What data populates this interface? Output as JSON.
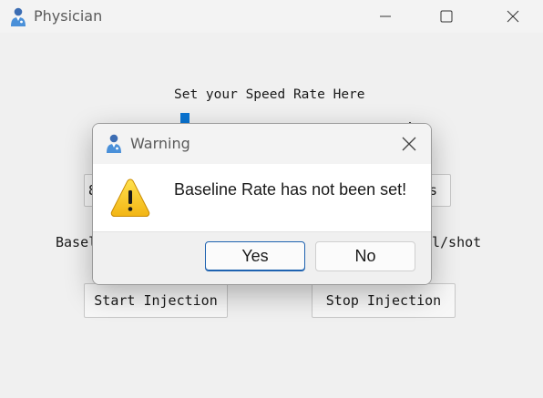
{
  "window": {
    "title": "Physician"
  },
  "main": {
    "speed_label": "Set your Speed Rate Here",
    "partial_button_left": "8",
    "partial_button_right": "s",
    "partial_label_left": "Basel",
    "partial_label_right": "l/shot",
    "start_button": "Start Injection",
    "stop_button": "Stop Injection"
  },
  "dialog": {
    "title": "Warning",
    "message": "Baseline Rate has not been set!",
    "yes_button": "Yes",
    "no_button": "No"
  },
  "icons": {
    "app": "doctor-icon",
    "warning": "warning-triangle-icon"
  },
  "colors": {
    "accent": "#0a74d2",
    "warning_fill": "#f7c325"
  }
}
